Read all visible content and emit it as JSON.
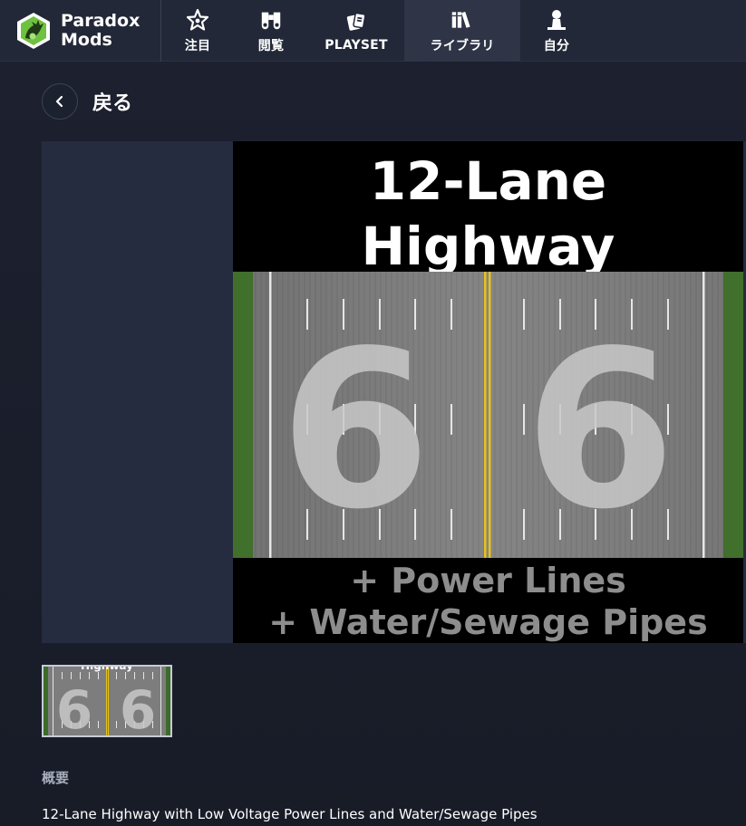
{
  "brand": {
    "line1": "Paradox",
    "line2": "Mods",
    "logo_icon": "hydra-logo-icon"
  },
  "nav": {
    "items": [
      {
        "label": "注目",
        "icon": "star-badge-icon",
        "active": false
      },
      {
        "label": "閲覧",
        "icon": "binoculars-icon",
        "active": false
      },
      {
        "label": "PLAYSET",
        "icon": "cards-icon",
        "active": false
      },
      {
        "label": "ライブラリ",
        "icon": "books-icon",
        "active": true
      },
      {
        "label": "自分",
        "icon": "person-icon",
        "active": false
      }
    ]
  },
  "back": {
    "label": "戻る",
    "icon": "chevron-left-icon"
  },
  "hero": {
    "title_line1": "12-Lane",
    "title_line2": "Highway",
    "road_number_left": "6",
    "road_number_right": "6",
    "sub_line1": "+ Power Lines",
    "sub_line2": "+ Water/Sewage Pipes"
  },
  "thumbnail": {
    "title_fragment": "Highway",
    "number_left": "6",
    "number_right": "6"
  },
  "description": {
    "section_label": "概要",
    "summary": "12-Lane Highway with Low Voltage Power Lines and Water/Sewage Pipes"
  },
  "colors": {
    "background": "#1a1e2b",
    "topbar": "#232838",
    "active_tab": "#2f3547",
    "gallery_panel": "#262c3f",
    "road_asphalt": "#7d7d7d",
    "grass": "#3c6b2a",
    "center_line": "#e8c21a",
    "muted_text": "#8d8d8d"
  }
}
